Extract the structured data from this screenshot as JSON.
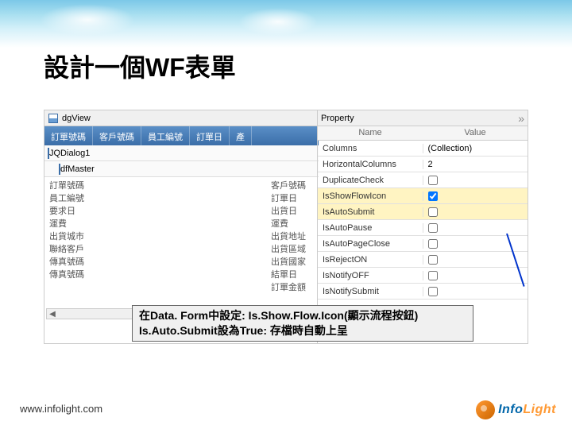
{
  "slide": {
    "title": "設計一個WF表單"
  },
  "left": {
    "dgView": "dgView",
    "cols": [
      "訂單號碼",
      "客戶號碼",
      "員工編號",
      "訂單日",
      "產"
    ],
    "jqDialog": "JQDialog1",
    "dfMaster": "dfMaster",
    "labelsL": [
      "訂單號碼",
      "員工編號",
      "要求日",
      "運費",
      "出貨城市",
      "聯絡客戶",
      "傳真號碼",
      "傳真號碼"
    ],
    "labelsR": [
      "客戶號碼",
      "訂單日",
      "出貨日",
      "運費",
      "出貨地址",
      "出貨區域",
      "出貨國家",
      "結單日",
      "訂單金額"
    ]
  },
  "property": {
    "title": "Property",
    "headers": [
      "Name",
      "Value"
    ],
    "rows": [
      {
        "name": "Columns",
        "value": "(Collection)",
        "type": "text"
      },
      {
        "name": "HorizontalColumns",
        "value": "2",
        "type": "text"
      },
      {
        "name": "DuplicateCheck",
        "value": false,
        "type": "check"
      },
      {
        "name": "IsShowFlowIcon",
        "value": true,
        "type": "check",
        "hl": true
      },
      {
        "name": "IsAutoSubmit",
        "value": false,
        "type": "check",
        "hl": true
      },
      {
        "name": "IsAutoPause",
        "value": false,
        "type": "check"
      },
      {
        "name": "IsAutoPageClose",
        "value": false,
        "type": "check"
      },
      {
        "name": "IsRejectON",
        "value": false,
        "type": "check"
      },
      {
        "name": "IsNotifyOFF",
        "value": false,
        "type": "check"
      },
      {
        "name": "IsNotifySubmit",
        "value": false,
        "type": "check"
      }
    ]
  },
  "callout": {
    "line1": "在Data. Form中設定: Is.Show.Flow.Icon(顯示流程按鈕)",
    "line2": "Is.Auto.Submit設為True: 存檔時自動上呈"
  },
  "footer": {
    "url": "www.infolight.com",
    "brand1": "Info",
    "brand2": "Light"
  }
}
